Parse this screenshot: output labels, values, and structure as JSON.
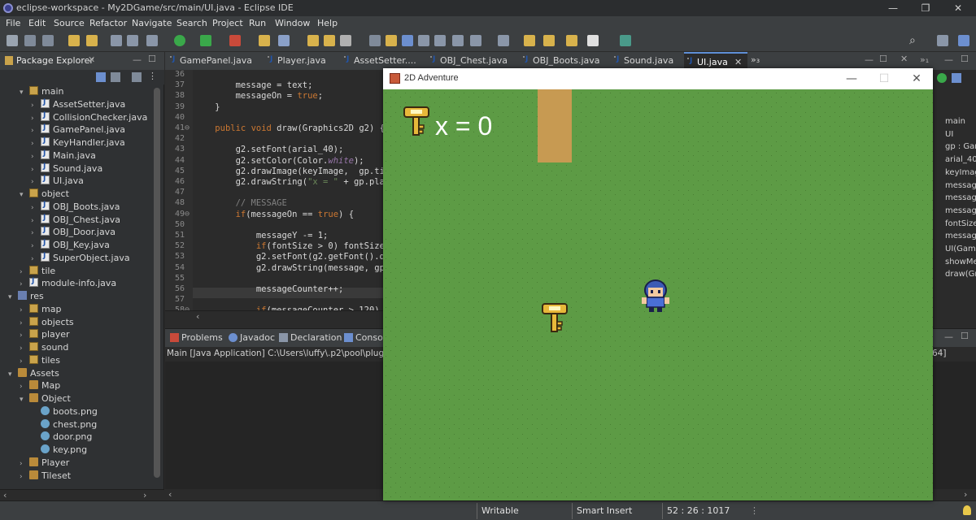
{
  "window": {
    "title": "eclipse-workspace - My2DGame/src/main/UI.java - Eclipse IDE",
    "controls": [
      "—",
      "❐",
      "✕"
    ]
  },
  "menu": [
    "File",
    "Edit",
    "Source",
    "Refactor",
    "Navigate",
    "Search",
    "Project",
    "Run",
    "Window",
    "Help"
  ],
  "package_explorer": {
    "title": "Package Explorer",
    "tree": [
      {
        "label": "main",
        "icon": "package-icon",
        "arrow": "v",
        "indent": 1
      },
      {
        "label": "AssetSetter.java",
        "icon": "java-file-icon",
        "arrow": ">",
        "indent": 2
      },
      {
        "label": "CollisionChecker.java",
        "icon": "java-file-icon",
        "arrow": ">",
        "indent": 2
      },
      {
        "label": "GamePanel.java",
        "icon": "java-file-icon",
        "arrow": ">",
        "indent": 2
      },
      {
        "label": "KeyHandler.java",
        "icon": "java-file-icon",
        "arrow": ">",
        "indent": 2
      },
      {
        "label": "Main.java",
        "icon": "java-file-icon",
        "arrow": ">",
        "indent": 2
      },
      {
        "label": "Sound.java",
        "icon": "java-file-icon",
        "arrow": ">",
        "indent": 2
      },
      {
        "label": "UI.java",
        "icon": "java-file-icon",
        "arrow": ">",
        "indent": 2
      },
      {
        "label": "object",
        "icon": "package-icon",
        "arrow": "v",
        "indent": 1
      },
      {
        "label": "OBJ_Boots.java",
        "icon": "java-file-icon",
        "arrow": ">",
        "indent": 2
      },
      {
        "label": "OBJ_Chest.java",
        "icon": "java-file-icon",
        "arrow": ">",
        "indent": 2
      },
      {
        "label": "OBJ_Door.java",
        "icon": "java-file-icon",
        "arrow": ">",
        "indent": 2
      },
      {
        "label": "OBJ_Key.java",
        "icon": "java-file-icon",
        "arrow": ">",
        "indent": 2
      },
      {
        "label": "SuperObject.java",
        "icon": "java-file-icon",
        "arrow": ">",
        "indent": 2
      },
      {
        "label": "tile",
        "icon": "package-icon",
        "arrow": ">",
        "indent": 1
      },
      {
        "label": "module-info.java",
        "icon": "java-file-icon",
        "arrow": ">",
        "indent": 1
      },
      {
        "label": "res",
        "icon": "source-folder-icon",
        "arrow": "v",
        "indent": 0
      },
      {
        "label": "map",
        "icon": "package-icon",
        "arrow": ">",
        "indent": 1
      },
      {
        "label": "objects",
        "icon": "package-icon",
        "arrow": ">",
        "indent": 1
      },
      {
        "label": "player",
        "icon": "package-icon",
        "arrow": ">",
        "indent": 1
      },
      {
        "label": "sound",
        "icon": "package-icon",
        "arrow": ">",
        "indent": 1
      },
      {
        "label": "tiles",
        "icon": "package-icon",
        "arrow": ">",
        "indent": 1
      },
      {
        "label": "Assets",
        "icon": "folder-icon",
        "arrow": "v",
        "indent": 0
      },
      {
        "label": "Map",
        "icon": "folder-icon",
        "arrow": ">",
        "indent": 1
      },
      {
        "label": "Object",
        "icon": "folder-icon",
        "arrow": "v",
        "indent": 1
      },
      {
        "label": "boots.png",
        "icon": "image-file-icon",
        "arrow": "",
        "indent": 2
      },
      {
        "label": "chest.png",
        "icon": "image-file-icon",
        "arrow": "",
        "indent": 2
      },
      {
        "label": "door.png",
        "icon": "image-file-icon",
        "arrow": "",
        "indent": 2
      },
      {
        "label": "key.png",
        "icon": "image-file-icon",
        "arrow": "",
        "indent": 2
      },
      {
        "label": "Player",
        "icon": "folder-icon",
        "arrow": ">",
        "indent": 1
      },
      {
        "label": "Tileset",
        "icon": "folder-icon",
        "arrow": ">",
        "indent": 1
      }
    ]
  },
  "editor": {
    "tabs": [
      {
        "label": "GamePanel.java",
        "active": false
      },
      {
        "label": "Player.java",
        "active": false
      },
      {
        "label": "AssetSetter....",
        "active": false
      },
      {
        "label": "OBJ_Chest.java",
        "active": false
      },
      {
        "label": "OBJ_Boots.java",
        "active": false
      },
      {
        "label": "Sound.java",
        "active": false
      },
      {
        "label": "UI.java",
        "active": true
      }
    ],
    "overflow_tabs": "»₃",
    "lines": [
      {
        "n": "36",
        "t": ""
      },
      {
        "n": "37",
        "t": "        message = text;"
      },
      {
        "n": "38",
        "t": "        messageOn = true;"
      },
      {
        "n": "39",
        "t": "    }"
      },
      {
        "n": "40",
        "t": ""
      },
      {
        "n": "41⊖",
        "t": "    public void draw(Graphics2D g2) {"
      },
      {
        "n": "42",
        "t": ""
      },
      {
        "n": "43",
        "t": "        g2.setFont(arial_40);"
      },
      {
        "n": "44",
        "t": "        g2.setColor(Color.white);"
      },
      {
        "n": "45",
        "t": "        g2.drawImage(keyImage,  gp.til"
      },
      {
        "n": "46",
        "t": "        g2.drawString(\"x = \" + gp.play"
      },
      {
        "n": "47",
        "t": ""
      },
      {
        "n": "48",
        "t": "        // MESSAGE"
      },
      {
        "n": "49⊖",
        "t": "        if(messageOn == true) {"
      },
      {
        "n": "50",
        "t": ""
      },
      {
        "n": "51",
        "t": "            messageY -= 1;"
      },
      {
        "n": "52",
        "t": "            if(fontSize > 0) fontSize"
      },
      {
        "n": "53",
        "t": "            g2.setFont(g2.getFont().de"
      },
      {
        "n": "54",
        "t": "            g2.drawString(message, gp."
      },
      {
        "n": "55",
        "t": ""
      },
      {
        "n": "56",
        "t": "            messageCounter++;"
      },
      {
        "n": "57",
        "t": ""
      },
      {
        "n": "58⊖",
        "t": "            if(messageCounter > 120) {"
      }
    ]
  },
  "console": {
    "tabs": [
      "Problems",
      "Javadoc",
      "Declaration",
      "Console"
    ],
    "run_line": "Main [Java Application] C:\\Users\\luffy\\.p2\\pool\\plugins\\",
    "run_line_suffix": "64]"
  },
  "outline": {
    "items": [
      "main",
      "UI",
      "gp : Gam",
      "arial_40",
      "keyImag",
      "message",
      "message",
      "message",
      "fontSize",
      "message",
      "UI(Game",
      "showMe",
      "draw(Gr"
    ]
  },
  "status": {
    "writable": "Writable",
    "insert_mode": "Smart Insert",
    "position": "52 : 26 : 1017"
  },
  "game": {
    "title": "2D Adventure",
    "hud_text": "x = 0",
    "controls": [
      "—",
      "☐",
      "✕"
    ]
  }
}
